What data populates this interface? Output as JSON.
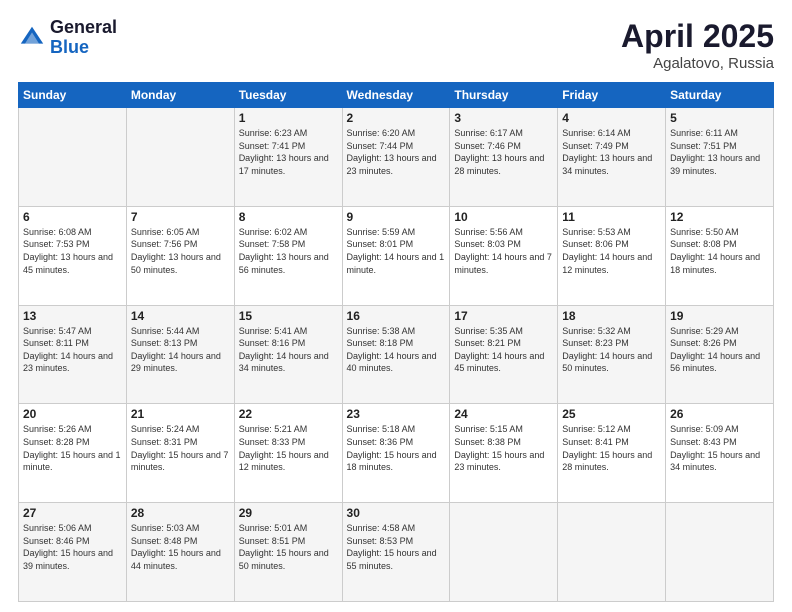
{
  "header": {
    "logo_general": "General",
    "logo_blue": "Blue",
    "month": "April 2025",
    "location": "Agalatovo, Russia"
  },
  "days_of_week": [
    "Sunday",
    "Monday",
    "Tuesday",
    "Wednesday",
    "Thursday",
    "Friday",
    "Saturday"
  ],
  "weeks": [
    [
      {
        "day": "",
        "info": ""
      },
      {
        "day": "",
        "info": ""
      },
      {
        "day": "1",
        "info": "Sunrise: 6:23 AM\nSunset: 7:41 PM\nDaylight: 13 hours and 17 minutes."
      },
      {
        "day": "2",
        "info": "Sunrise: 6:20 AM\nSunset: 7:44 PM\nDaylight: 13 hours and 23 minutes."
      },
      {
        "day": "3",
        "info": "Sunrise: 6:17 AM\nSunset: 7:46 PM\nDaylight: 13 hours and 28 minutes."
      },
      {
        "day": "4",
        "info": "Sunrise: 6:14 AM\nSunset: 7:49 PM\nDaylight: 13 hours and 34 minutes."
      },
      {
        "day": "5",
        "info": "Sunrise: 6:11 AM\nSunset: 7:51 PM\nDaylight: 13 hours and 39 minutes."
      }
    ],
    [
      {
        "day": "6",
        "info": "Sunrise: 6:08 AM\nSunset: 7:53 PM\nDaylight: 13 hours and 45 minutes."
      },
      {
        "day": "7",
        "info": "Sunrise: 6:05 AM\nSunset: 7:56 PM\nDaylight: 13 hours and 50 minutes."
      },
      {
        "day": "8",
        "info": "Sunrise: 6:02 AM\nSunset: 7:58 PM\nDaylight: 13 hours and 56 minutes."
      },
      {
        "day": "9",
        "info": "Sunrise: 5:59 AM\nSunset: 8:01 PM\nDaylight: 14 hours and 1 minute."
      },
      {
        "day": "10",
        "info": "Sunrise: 5:56 AM\nSunset: 8:03 PM\nDaylight: 14 hours and 7 minutes."
      },
      {
        "day": "11",
        "info": "Sunrise: 5:53 AM\nSunset: 8:06 PM\nDaylight: 14 hours and 12 minutes."
      },
      {
        "day": "12",
        "info": "Sunrise: 5:50 AM\nSunset: 8:08 PM\nDaylight: 14 hours and 18 minutes."
      }
    ],
    [
      {
        "day": "13",
        "info": "Sunrise: 5:47 AM\nSunset: 8:11 PM\nDaylight: 14 hours and 23 minutes."
      },
      {
        "day": "14",
        "info": "Sunrise: 5:44 AM\nSunset: 8:13 PM\nDaylight: 14 hours and 29 minutes."
      },
      {
        "day": "15",
        "info": "Sunrise: 5:41 AM\nSunset: 8:16 PM\nDaylight: 14 hours and 34 minutes."
      },
      {
        "day": "16",
        "info": "Sunrise: 5:38 AM\nSunset: 8:18 PM\nDaylight: 14 hours and 40 minutes."
      },
      {
        "day": "17",
        "info": "Sunrise: 5:35 AM\nSunset: 8:21 PM\nDaylight: 14 hours and 45 minutes."
      },
      {
        "day": "18",
        "info": "Sunrise: 5:32 AM\nSunset: 8:23 PM\nDaylight: 14 hours and 50 minutes."
      },
      {
        "day": "19",
        "info": "Sunrise: 5:29 AM\nSunset: 8:26 PM\nDaylight: 14 hours and 56 minutes."
      }
    ],
    [
      {
        "day": "20",
        "info": "Sunrise: 5:26 AM\nSunset: 8:28 PM\nDaylight: 15 hours and 1 minute."
      },
      {
        "day": "21",
        "info": "Sunrise: 5:24 AM\nSunset: 8:31 PM\nDaylight: 15 hours and 7 minutes."
      },
      {
        "day": "22",
        "info": "Sunrise: 5:21 AM\nSunset: 8:33 PM\nDaylight: 15 hours and 12 minutes."
      },
      {
        "day": "23",
        "info": "Sunrise: 5:18 AM\nSunset: 8:36 PM\nDaylight: 15 hours and 18 minutes."
      },
      {
        "day": "24",
        "info": "Sunrise: 5:15 AM\nSunset: 8:38 PM\nDaylight: 15 hours and 23 minutes."
      },
      {
        "day": "25",
        "info": "Sunrise: 5:12 AM\nSunset: 8:41 PM\nDaylight: 15 hours and 28 minutes."
      },
      {
        "day": "26",
        "info": "Sunrise: 5:09 AM\nSunset: 8:43 PM\nDaylight: 15 hours and 34 minutes."
      }
    ],
    [
      {
        "day": "27",
        "info": "Sunrise: 5:06 AM\nSunset: 8:46 PM\nDaylight: 15 hours and 39 minutes."
      },
      {
        "day": "28",
        "info": "Sunrise: 5:03 AM\nSunset: 8:48 PM\nDaylight: 15 hours and 44 minutes."
      },
      {
        "day": "29",
        "info": "Sunrise: 5:01 AM\nSunset: 8:51 PM\nDaylight: 15 hours and 50 minutes."
      },
      {
        "day": "30",
        "info": "Sunrise: 4:58 AM\nSunset: 8:53 PM\nDaylight: 15 hours and 55 minutes."
      },
      {
        "day": "",
        "info": ""
      },
      {
        "day": "",
        "info": ""
      },
      {
        "day": "",
        "info": ""
      }
    ]
  ]
}
